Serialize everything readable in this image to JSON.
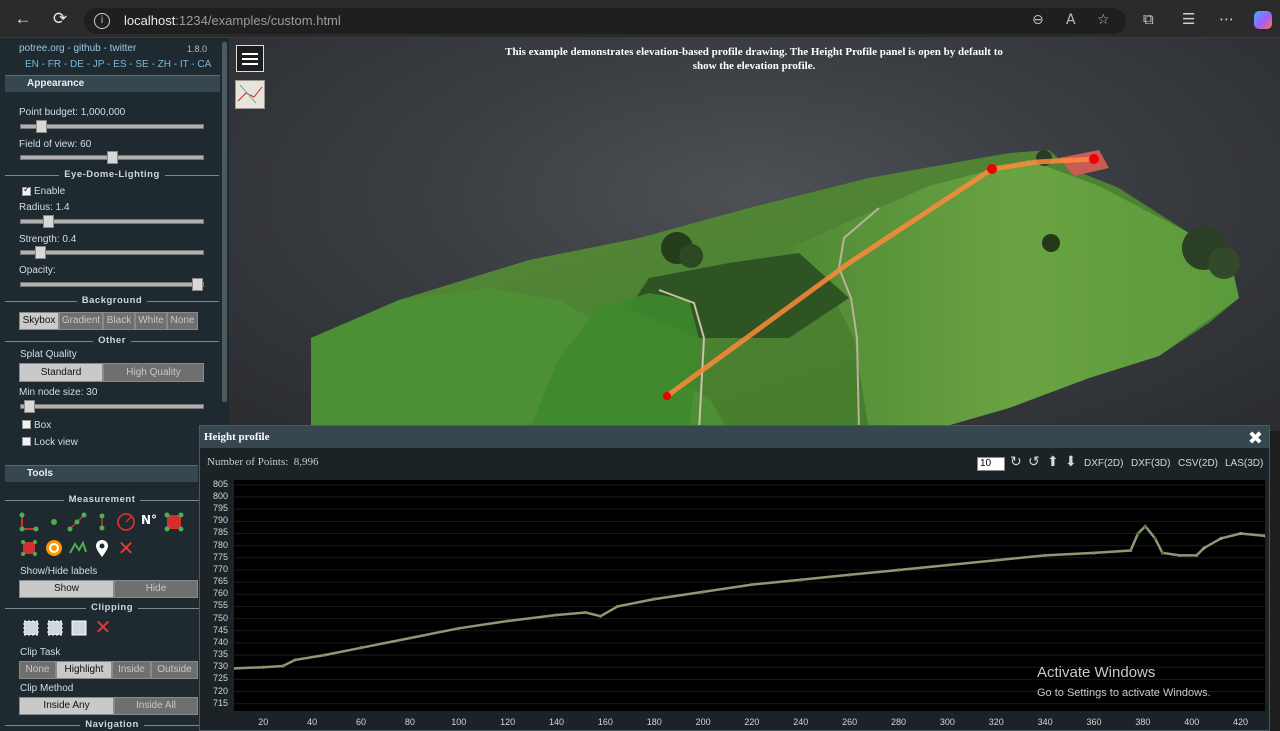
{
  "browser": {
    "url_host": "localhost",
    "url_rest": ":1234/examples/custom.html",
    "back_icon": "back-arrow-icon",
    "refresh_icon": "refresh-icon"
  },
  "sidebar": {
    "top_links": "potree.org - github - twitter",
    "version": "1.8.0",
    "languages": "EN - FR - DE - JP - ES - SE - ZH - IT - CA",
    "appearance": {
      "header": "Appearance",
      "point_budget_label": "Point budget: 1,000,000",
      "point_budget_level": 0.09,
      "fov_label": "Field of view: 60",
      "fov_level": 0.5,
      "edl_title": "Eye-Dome-Lighting",
      "edl_enable_label": "Enable",
      "edl_enabled": true,
      "radius_label": "Radius: 1.4",
      "radius_level": 0.13,
      "strength_label": "Strength: 0.4",
      "strength_level": 0.08,
      "opacity_label": "Opacity:",
      "opacity_level": 1.0,
      "background_title": "Background",
      "background_options": [
        "Skybox",
        "Gradient",
        "Black",
        "White",
        "None"
      ],
      "background_selected": "Skybox",
      "other_title": "Other",
      "splat_quality_label": "Splat Quality",
      "splat_options": [
        "Standard",
        "High Quality"
      ],
      "splat_selected": "Standard",
      "min_node_label": "Min node size: 30",
      "min_node_level": 0.02,
      "box_label": "Box",
      "lock_view_label": "Lock view"
    },
    "tools": {
      "header": "Tools",
      "measurement_title": "Measurement",
      "show_hide_label": "Show/Hide labels",
      "show_label": "Show",
      "hide_label": "Hide",
      "clipping_title": "Clipping",
      "clip_task_label": "Clip Task",
      "clip_task_options": [
        "None",
        "Highlight",
        "Inside",
        "Outside"
      ],
      "clip_task_selected": "Highlight",
      "clip_method_label": "Clip Method",
      "clip_method_options": [
        "Inside Any",
        "Inside All"
      ],
      "clip_method_selected": "Inside Any",
      "navigation_title": "Navigation"
    }
  },
  "viewer": {
    "caption": "This example demonstrates elevation-based profile drawing. The Height Profile panel is open by default to show the elevation profile."
  },
  "height_profile": {
    "title": "Height profile",
    "points_label": "Number of Points:",
    "points_value": "8,996",
    "width_input": "10",
    "exports": [
      "DXF(2D)",
      "DXF(3D)",
      "CSV(2D)",
      "LAS(3D)"
    ],
    "watermark_title": "Activate Windows",
    "watermark_sub": "Go to Settings to activate Windows."
  },
  "chart_data": {
    "type": "scatter",
    "xlabel": "",
    "ylabel": "",
    "xlim": [
      8,
      430
    ],
    "ylim": [
      712,
      807
    ],
    "x_ticks": [
      20,
      40,
      60,
      80,
      100,
      120,
      140,
      160,
      180,
      200,
      220,
      240,
      260,
      280,
      300,
      320,
      340,
      360,
      380,
      400,
      420
    ],
    "y_ticks": [
      715,
      720,
      725,
      730,
      735,
      740,
      745,
      750,
      755,
      760,
      765,
      770,
      775,
      780,
      785,
      790,
      795,
      800,
      805
    ],
    "series": [
      {
        "values": [
          {
            "x": 8,
            "y": 729.5
          },
          {
            "x": 20,
            "y": 730
          },
          {
            "x": 28,
            "y": 730.5
          },
          {
            "x": 33,
            "y": 733
          },
          {
            "x": 45,
            "y": 735
          },
          {
            "x": 60,
            "y": 738
          },
          {
            "x": 80,
            "y": 742
          },
          {
            "x": 100,
            "y": 746
          },
          {
            "x": 120,
            "y": 749
          },
          {
            "x": 140,
            "y": 751.5
          },
          {
            "x": 152,
            "y": 752.5
          },
          {
            "x": 158,
            "y": 751
          },
          {
            "x": 165,
            "y": 755
          },
          {
            "x": 180,
            "y": 758
          },
          {
            "x": 200,
            "y": 761
          },
          {
            "x": 220,
            "y": 764
          },
          {
            "x": 240,
            "y": 766
          },
          {
            "x": 260,
            "y": 768
          },
          {
            "x": 280,
            "y": 770
          },
          {
            "x": 300,
            "y": 772
          },
          {
            "x": 320,
            "y": 774
          },
          {
            "x": 340,
            "y": 776
          },
          {
            "x": 360,
            "y": 777
          },
          {
            "x": 375,
            "y": 778
          },
          {
            "x": 378,
            "y": 785
          },
          {
            "x": 381,
            "y": 788
          },
          {
            "x": 385,
            "y": 783
          },
          {
            "x": 388,
            "y": 777
          },
          {
            "x": 395,
            "y": 776
          },
          {
            "x": 402,
            "y": 776
          },
          {
            "x": 405,
            "y": 779
          },
          {
            "x": 412,
            "y": 783
          },
          {
            "x": 420,
            "y": 785
          },
          {
            "x": 430,
            "y": 784
          }
        ]
      }
    ]
  }
}
